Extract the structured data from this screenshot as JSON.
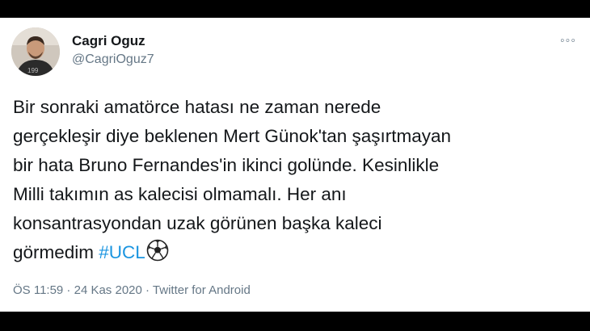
{
  "user": {
    "name": "Cagri Oguz",
    "handle": "@CagriOguz7"
  },
  "more_label": "◦◦◦",
  "tweet": {
    "text": "Bir sonraki amatörce hatası ne zaman nerede\ngerçekleşir diye beklenen Mert Günok'tan şaşırtmayan\nbir hata Bruno Fernandes'in ikinci golünde. Kesinlikle\nMilli takımın as kalecisi olmamalı. Her anı\nkonsantrasyondan uzak görünen başka kaleci\ngörmedim ",
    "hashtag": "#UCL",
    "emoji_icon": "soccer-ball-icon"
  },
  "meta": {
    "time": "ÖS 11:59",
    "separator": " · ",
    "date": "24 Kas 2020",
    "source": "Twitter for Android"
  },
  "colors": {
    "accent": "#1b95e0",
    "secondary_text": "#657786",
    "primary_text": "#14171a"
  }
}
